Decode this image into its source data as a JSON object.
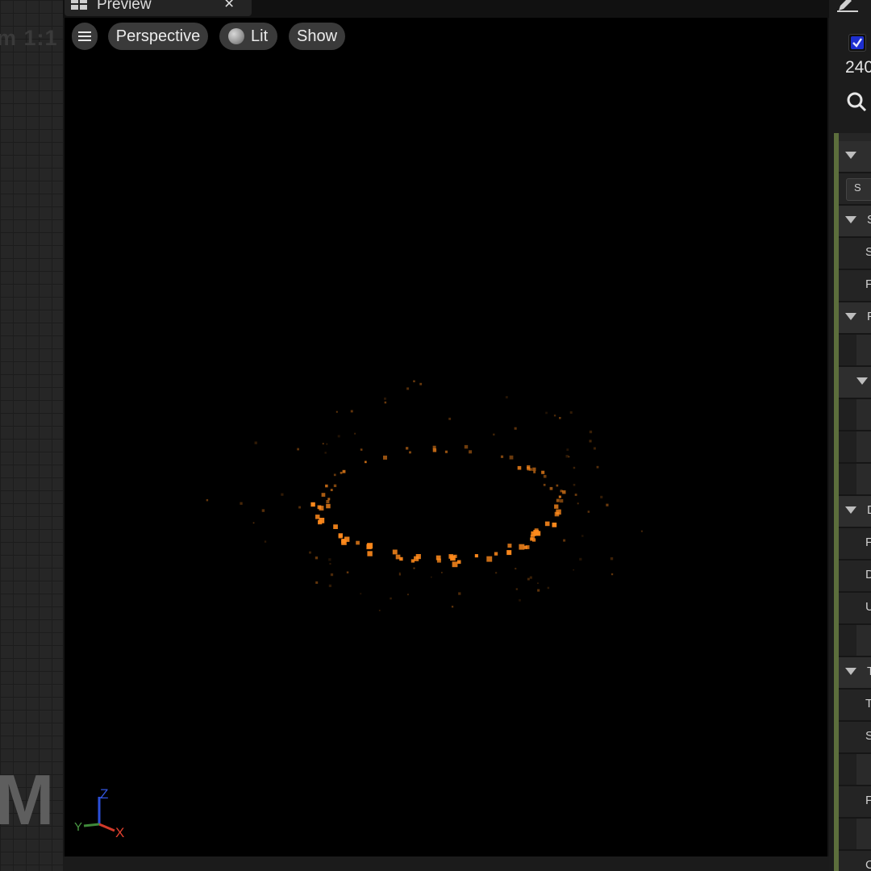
{
  "left_panel": {
    "zoom_label": "m 1:1",
    "watermark": "M"
  },
  "tab": {
    "title": "Preview",
    "close_glyph": "×"
  },
  "viewport_toolbar": {
    "menu_icon": "hamburger-menu-icon",
    "perspective_label": "Perspective",
    "lit_label": "Lit",
    "show_label": "Show"
  },
  "axis_gizmo": {
    "x_label": "X",
    "y_label": "Y",
    "z_label": "Z",
    "x_color": "#d23a2a",
    "y_color": "#3f8a3a",
    "z_color": "#2b4fd8"
  },
  "particles": {
    "color": "#ff8a1c",
    "shape": "ring"
  },
  "right_panel": {
    "checkbox_checked": true,
    "value_text": "240",
    "rows": [
      {
        "kind": "section",
        "text": ""
      },
      {
        "kind": "boxed",
        "text": "S"
      },
      {
        "kind": "section",
        "text": "S"
      },
      {
        "kind": "field",
        "text": "S"
      },
      {
        "kind": "field",
        "text": "F"
      },
      {
        "kind": "section",
        "text": "F"
      },
      {
        "kind": "empty",
        "text": ""
      },
      {
        "kind": "subsection",
        "text": ""
      },
      {
        "kind": "empty",
        "text": ""
      },
      {
        "kind": "empty",
        "text": ""
      },
      {
        "kind": "empty",
        "text": ""
      },
      {
        "kind": "section",
        "text": "D"
      },
      {
        "kind": "field",
        "text": "F"
      },
      {
        "kind": "field",
        "text": "D"
      },
      {
        "kind": "field",
        "text": "U"
      },
      {
        "kind": "empty",
        "text": ""
      },
      {
        "kind": "section",
        "text": "T"
      },
      {
        "kind": "field",
        "text": "T"
      },
      {
        "kind": "field",
        "text": "S"
      },
      {
        "kind": "empty",
        "text": ""
      },
      {
        "kind": "field",
        "text": "F"
      },
      {
        "kind": "empty",
        "text": ""
      },
      {
        "kind": "field",
        "text": "C"
      }
    ]
  }
}
